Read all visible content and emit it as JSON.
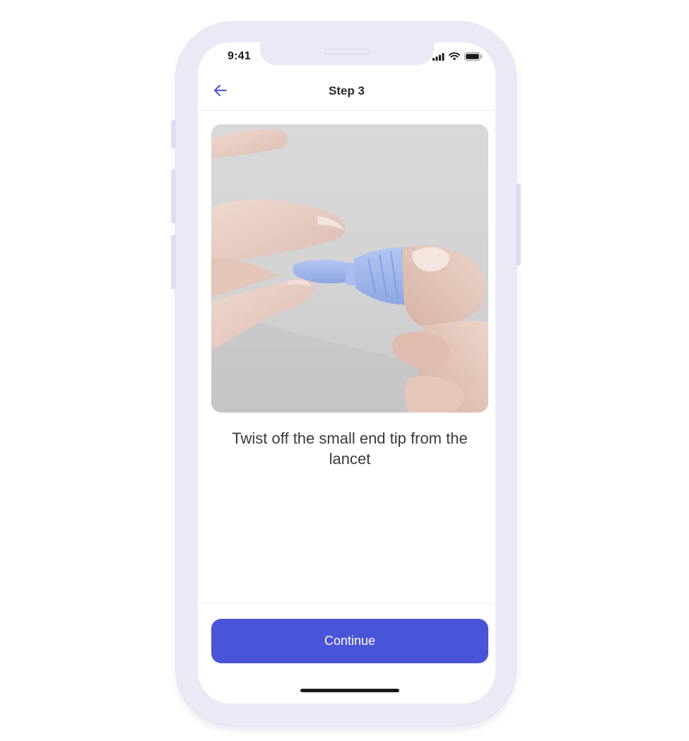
{
  "status_bar": {
    "time": "9:41",
    "icons": [
      "signal-icon",
      "wifi-icon",
      "battery-icon"
    ]
  },
  "header": {
    "title": "Step 3",
    "back_icon": "arrow-left-icon"
  },
  "illustration": {
    "subject": "hands-twisting-lancet-tip"
  },
  "instruction": {
    "text": "Twist off the small end tip from the lancet"
  },
  "footer": {
    "continue_label": "Continue"
  },
  "colors": {
    "accent": "#4a54d9",
    "back_arrow": "#4a54d9",
    "frame": "#ece9f7",
    "lancet": "#9fb6ea"
  }
}
